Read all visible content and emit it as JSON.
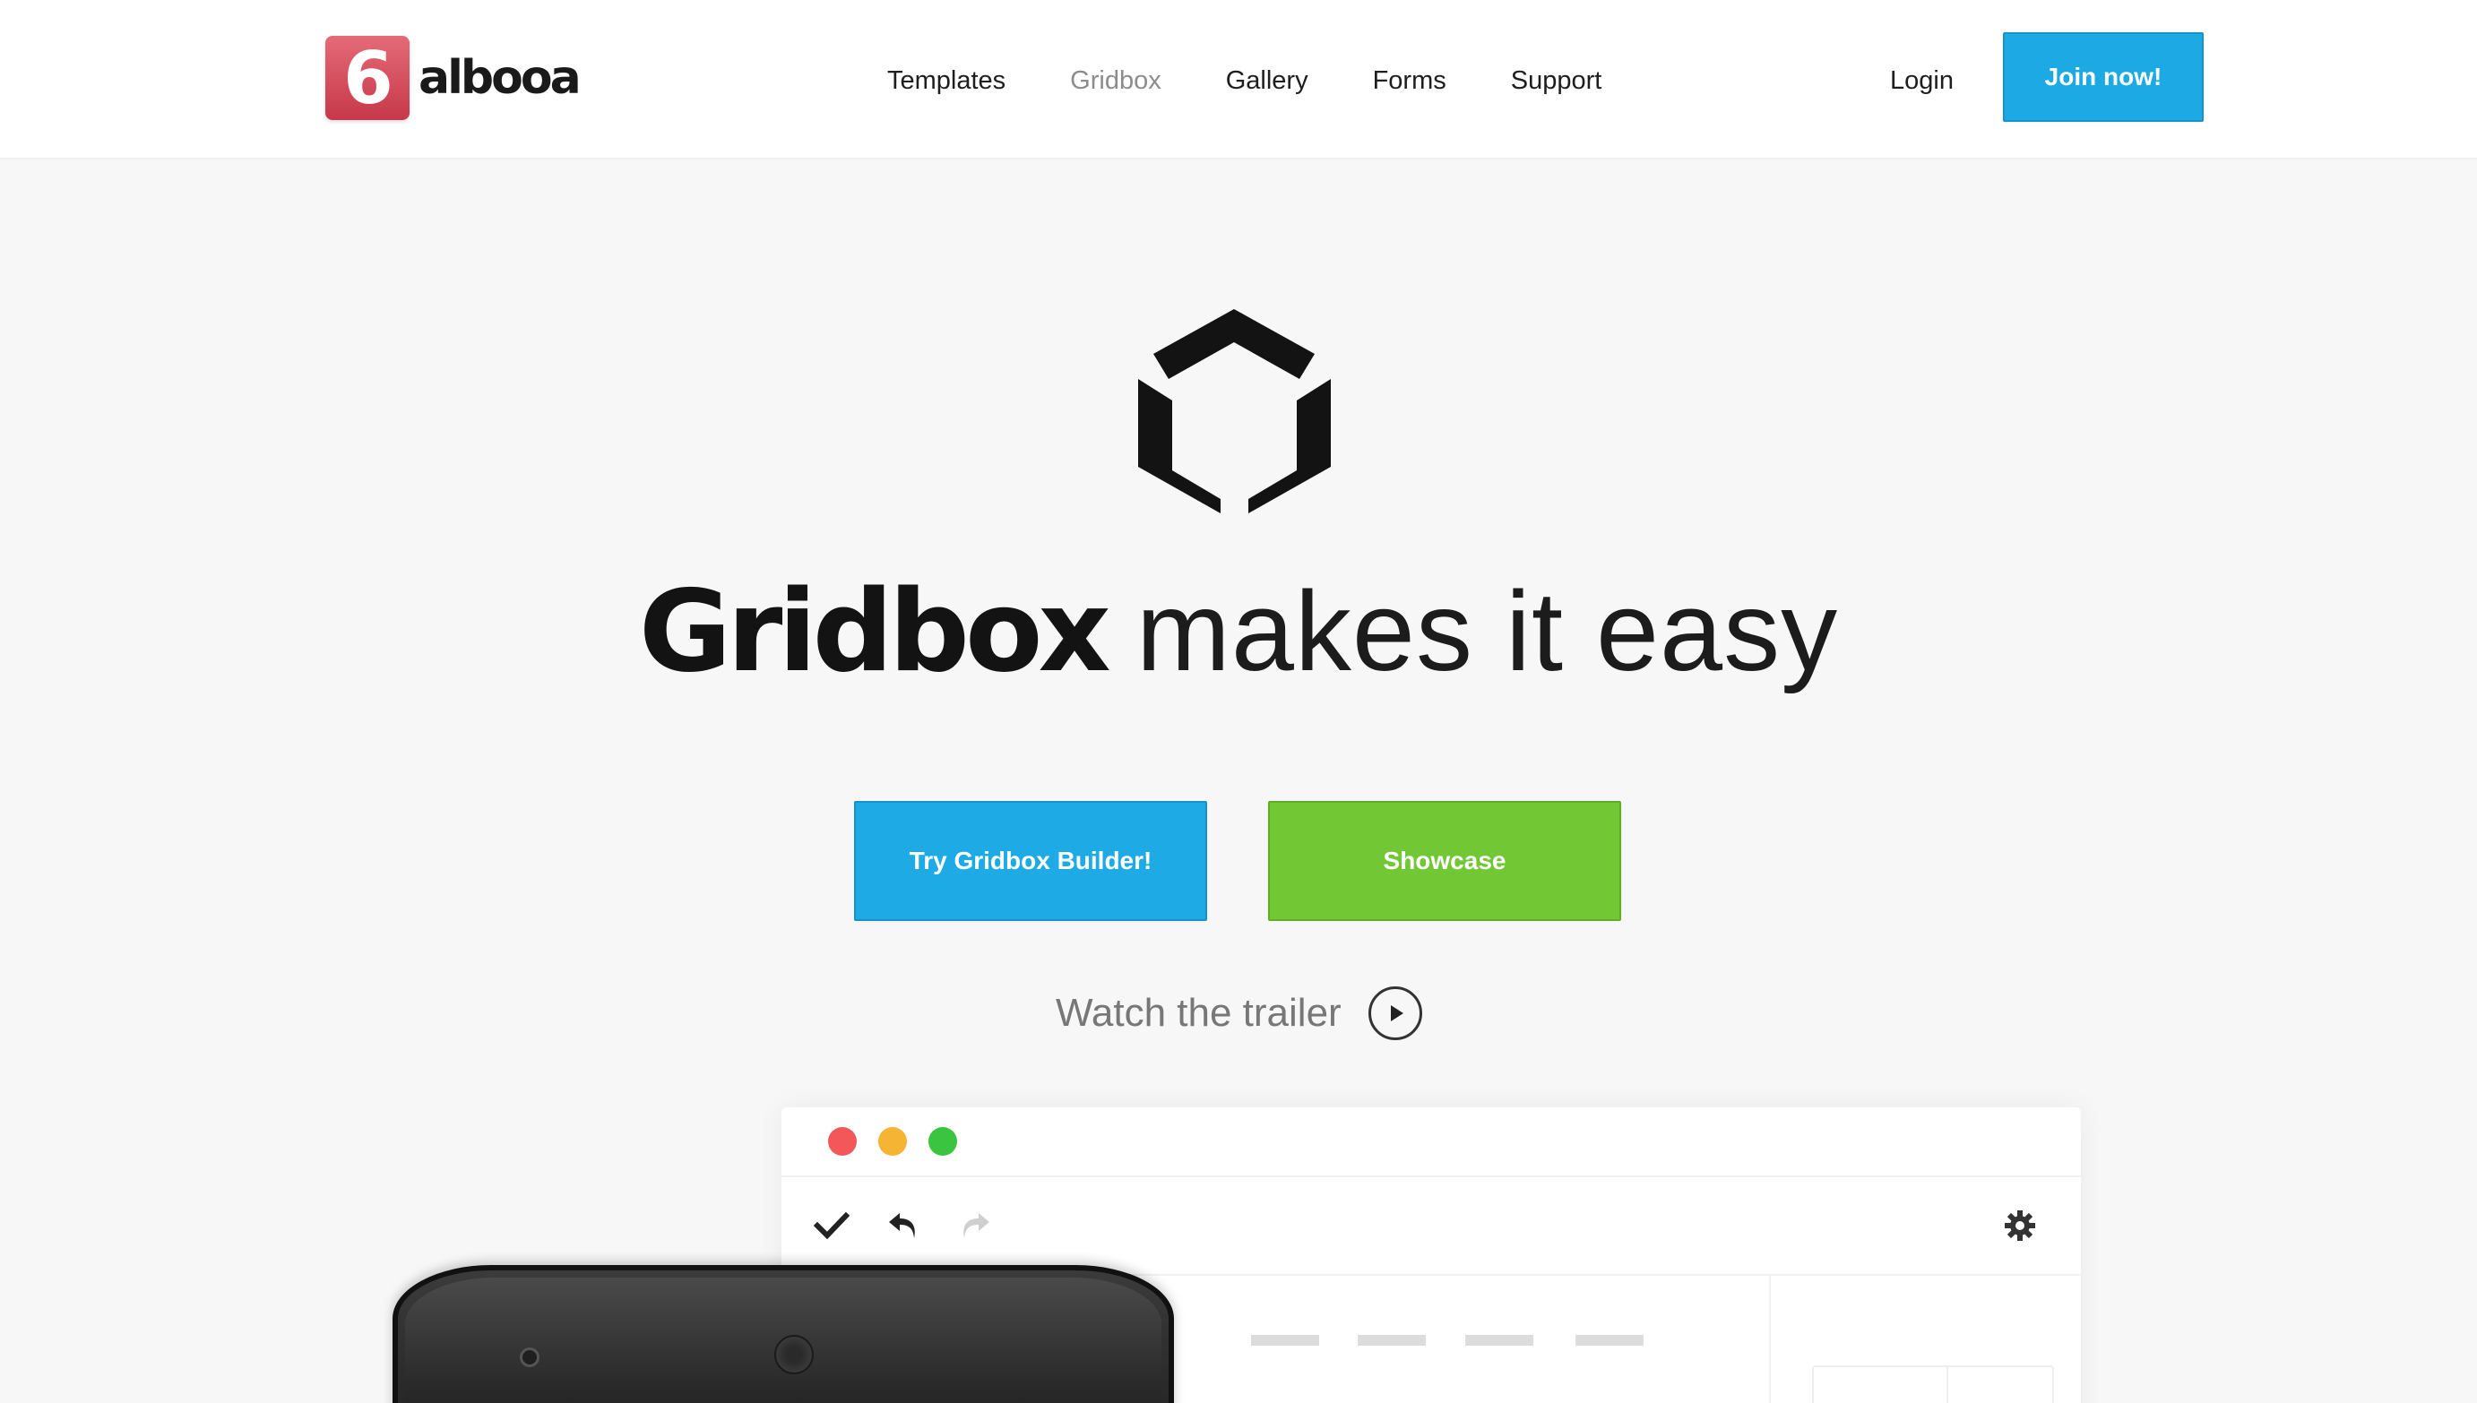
{
  "header": {
    "logo_digit": "6",
    "logo_text": "albooa",
    "nav": [
      {
        "label": "Templates",
        "active": false
      },
      {
        "label": "Gridbox",
        "active": true
      },
      {
        "label": "Gallery",
        "active": false
      },
      {
        "label": "Forms",
        "active": false
      },
      {
        "label": "Support",
        "active": false
      }
    ],
    "login_label": "Login",
    "join_label": "Join now!"
  },
  "hero": {
    "logo_icon": "gridbox-hex-icon",
    "title_strong": "Gridbox",
    "title_light": "makes it easy",
    "try_label": "Try Gridbox Builder!",
    "showcase_label": "Showcase",
    "trailer_label": "Watch the trailer"
  },
  "colors": {
    "primary_blue": "#1eaae5",
    "showcase_green": "#72c735",
    "logo_red": "#d9505f",
    "window_red": "#f4575a",
    "window_yellow": "#f5b434",
    "window_green": "#3bc440"
  },
  "app_window": {
    "toolbar_icons": [
      "check-icon",
      "undo-icon",
      "redo-icon",
      "gear-icon"
    ]
  }
}
